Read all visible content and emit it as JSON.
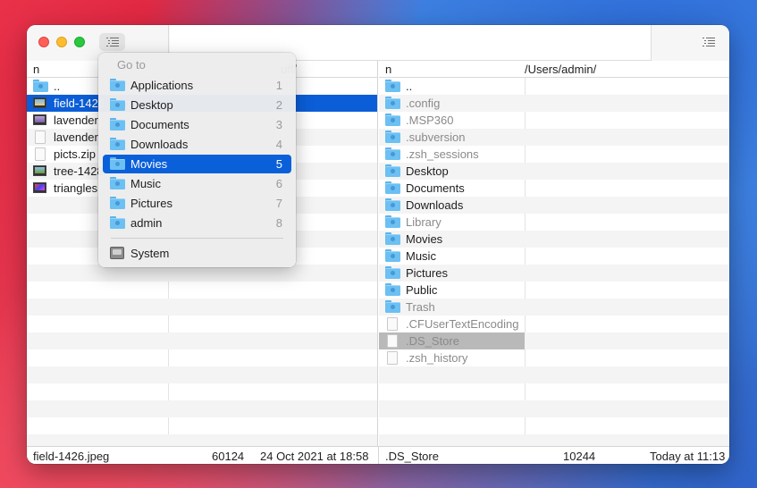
{
  "window": {
    "traffic_lights": [
      "close",
      "minimize",
      "zoom"
    ],
    "left_menu_icon": "list-icon",
    "right_menu_icon": "list-icon"
  },
  "goto_menu": {
    "header": "Go to",
    "items": [
      {
        "label": "Applications",
        "shortcut": "1",
        "icon": "folder-applications-icon"
      },
      {
        "label": "Desktop",
        "shortcut": "2",
        "icon": "folder-desktop-icon"
      },
      {
        "label": "Documents",
        "shortcut": "3",
        "icon": "folder-documents-icon"
      },
      {
        "label": "Downloads",
        "shortcut": "4",
        "icon": "folder-downloads-icon"
      },
      {
        "label": "Movies",
        "shortcut": "5",
        "icon": "folder-movies-icon",
        "selected": true
      },
      {
        "label": "Music",
        "shortcut": "6",
        "icon": "folder-music-icon"
      },
      {
        "label": "Pictures",
        "shortcut": "7",
        "icon": "folder-pictures-icon"
      },
      {
        "label": "admin",
        "shortcut": "8",
        "icon": "folder-home-icon"
      }
    ],
    "system_item": {
      "label": "System",
      "icon": "disk-icon"
    }
  },
  "left_pane": {
    "header_name": "n",
    "header_path": "uff/",
    "files": [
      {
        "name": "..",
        "type": "folder"
      },
      {
        "name": "field-1426.jpeg",
        "type": "image",
        "selected": true
      },
      {
        "name": "lavender",
        "type": "image"
      },
      {
        "name": "lavender",
        "type": "document"
      },
      {
        "name": "picts.zip",
        "type": "document"
      },
      {
        "name": "tree-1428",
        "type": "image"
      },
      {
        "name": "triangles",
        "type": "image"
      }
    ]
  },
  "right_pane": {
    "header_name": "n",
    "header_path": "/Users/admin/",
    "files": [
      {
        "name": "..",
        "type": "folder"
      },
      {
        "name": ".config",
        "type": "folder",
        "hidden": true
      },
      {
        "name": ".MSP360",
        "type": "folder",
        "hidden": true
      },
      {
        "name": ".subversion",
        "type": "folder",
        "hidden": true
      },
      {
        "name": ".zsh_sessions",
        "type": "folder",
        "hidden": true
      },
      {
        "name": "Desktop",
        "type": "folder"
      },
      {
        "name": "Documents",
        "type": "folder"
      },
      {
        "name": "Downloads",
        "type": "folder"
      },
      {
        "name": "Library",
        "type": "folder",
        "hidden": true
      },
      {
        "name": "Movies",
        "type": "folder"
      },
      {
        "name": "Music",
        "type": "folder"
      },
      {
        "name": "Pictures",
        "type": "folder"
      },
      {
        "name": "Public",
        "type": "folder"
      },
      {
        "name": "Trash",
        "type": "folder",
        "hidden": true
      },
      {
        "name": ".CFUserTextEncoding",
        "type": "document",
        "hidden": true
      },
      {
        "name": ".DS_Store",
        "type": "document",
        "hidden": true,
        "selected": true
      },
      {
        "name": ".zsh_history",
        "type": "document",
        "hidden": true
      }
    ]
  },
  "status_left": {
    "name": "field-1426.jpeg",
    "size": "60124",
    "date": "24 Oct 2021 at 18:58"
  },
  "status_right": {
    "name": ".DS_Store",
    "size": "10244",
    "date": "Today at 11:13"
  }
}
